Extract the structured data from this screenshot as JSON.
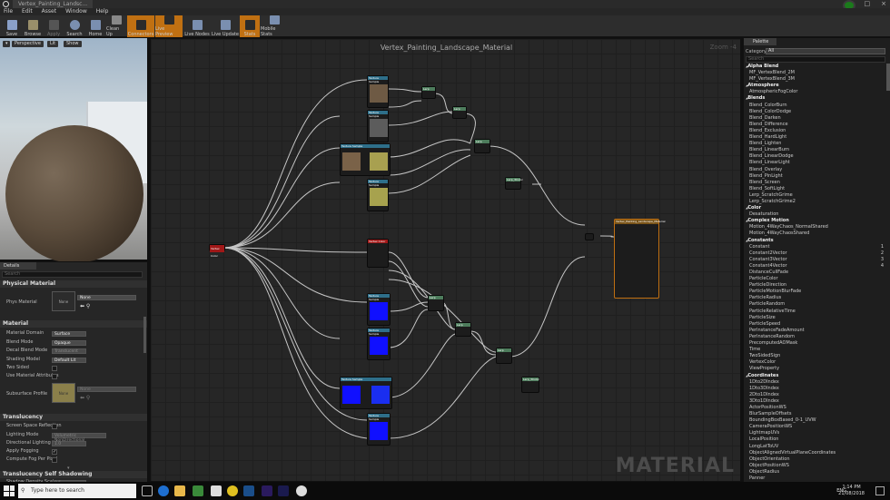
{
  "window": {
    "tab_title": "Vertex_Painting_Landsc..."
  },
  "menu": [
    "File",
    "Edit",
    "Asset",
    "Window",
    "Help"
  ],
  "toolbar": [
    {
      "label": "Save",
      "icon": "save-icon",
      "active": false
    },
    {
      "label": "Browse",
      "icon": "browse-icon",
      "active": false
    },
    {
      "label": "Apply",
      "icon": "apply-icon",
      "active": false
    },
    {
      "label": "Search",
      "icon": "search-icon",
      "active": false
    },
    {
      "label": "Home",
      "icon": "home-icon",
      "active": false
    },
    {
      "label": "Clean Up",
      "icon": "cleanup-icon",
      "active": false
    },
    {
      "label": "Connectors",
      "icon": "connectors-icon",
      "active": true
    },
    {
      "label": "Live Preview",
      "icon": "live-preview-icon",
      "active": true
    },
    {
      "label": "Live Nodes",
      "icon": "live-nodes-icon",
      "active": false
    },
    {
      "label": "Live Update",
      "icon": "live-update-icon",
      "active": false
    },
    {
      "label": "Stats",
      "icon": "stats-icon",
      "active": true
    },
    {
      "label": "Mobile Stats",
      "icon": "mobile-stats-icon",
      "active": false
    }
  ],
  "viewport": {
    "buttons": [
      "Perspective",
      "Lit",
      "Show"
    ]
  },
  "details": {
    "tab": "Details",
    "search_placeholder": "Search",
    "physical_material": {
      "header": "Physical Material",
      "label": "Phys Material",
      "thumb_text": "None",
      "value": "None"
    },
    "material": {
      "header": "Material",
      "rows": [
        {
          "label": "Material Domain",
          "value": "Surface"
        },
        {
          "label": "Blend Mode",
          "value": "Opaque"
        },
        {
          "label": "Decal Blend Mode",
          "value": "Translucent"
        },
        {
          "label": "Shading Model",
          "value": "Default Lit"
        }
      ],
      "two_sided": "Two Sided",
      "use_attributes": "Use Material Attributes",
      "subsurface": "Subsurface Profile",
      "subsurface_thumb": "None",
      "subsurface_value": "None"
    },
    "translucency": {
      "header": "Translucency",
      "rows": [
        {
          "label": "Screen Space Reflection",
          "type": "check",
          "checked": false
        },
        {
          "label": "Lighting Mode",
          "type": "dropdown",
          "value": "Volumetric NonDirectional"
        },
        {
          "label": "Directional Lighting Inte",
          "type": "number",
          "value": "1.0"
        },
        {
          "label": "Apply Fogging",
          "type": "check",
          "checked": true
        },
        {
          "label": "Compute Fog Per Pixel",
          "type": "check",
          "checked": false
        }
      ]
    },
    "translucency_self_shadowing": {
      "header": "Translucency Self Shadowing",
      "label": "Shadow Density Scale",
      "value": "0.5"
    }
  },
  "graph": {
    "title": "Vertex_Painting_Landscape_Material",
    "zoom": "Zoom -4",
    "watermark": "MATERIAL",
    "result_node": "Vertex_Painting_Landscape_Material",
    "vertex_color_node": "Vertex Color",
    "texture_node": "Texture Sample",
    "lerp_node": "Lerp",
    "lerp_3color_node": "Lerp_3Color",
    "pins": [
      "Base Color",
      "Metallic",
      "Specular",
      "Roughness",
      "Emissive Color",
      "Opacity",
      "Opacity Mask",
      "Normal",
      "World Position Offset",
      "World Displacement",
      "Tessellation Multiplier",
      "Subsurface Color",
      "Custom Data 0",
      "Custom Data 1",
      "Ambient Occlusion",
      "Refraction",
      "Pixel Depth Offset"
    ]
  },
  "palette": {
    "tab": "Palette",
    "category_label": "Category",
    "category_value": "All",
    "search_placeholder": "Search",
    "items": [
      {
        "t": "Alpha Blend",
        "h": true
      },
      {
        "t": "MF_VertexBlend_2M"
      },
      {
        "t": "MF_VertexBlend_3M"
      },
      {
        "t": "Atmosphere",
        "h": true
      },
      {
        "t": "AtmosphericFogColor"
      },
      {
        "t": "Blends",
        "h": true
      },
      {
        "t": "Blend_ColorBurn"
      },
      {
        "t": "Blend_ColorDodge"
      },
      {
        "t": "Blend_Darken"
      },
      {
        "t": "Blend_Difference"
      },
      {
        "t": "Blend_Exclusion"
      },
      {
        "t": "Blend_HardLight"
      },
      {
        "t": "Blend_Lighten"
      },
      {
        "t": "Blend_LinearBurn"
      },
      {
        "t": "Blend_LinearDodge"
      },
      {
        "t": "Blend_LinearLight"
      },
      {
        "t": "Blend_Overlay"
      },
      {
        "t": "Blend_PinLight"
      },
      {
        "t": "Blend_Screen"
      },
      {
        "t": "Blend_SoftLight"
      },
      {
        "t": "Lerp_ScratchGrime"
      },
      {
        "t": "Lerp_ScratchGrime2"
      },
      {
        "t": "Color",
        "h": true
      },
      {
        "t": "Desaturation"
      },
      {
        "t": "Complex Motion",
        "h": true
      },
      {
        "t": "Motion_4WayChaos_NormalShared"
      },
      {
        "t": "Motion_4WayChaosShared"
      },
      {
        "t": "Constants",
        "h": true
      },
      {
        "t": "Constant",
        "k": "1"
      },
      {
        "t": "Constant2Vector",
        "k": "2"
      },
      {
        "t": "Constant3Vector",
        "k": "3"
      },
      {
        "t": "Constant4Vector",
        "k": "4"
      },
      {
        "t": "DistanceCullFade"
      },
      {
        "t": "ParticleColor"
      },
      {
        "t": "ParticleDirection"
      },
      {
        "t": "ParticleMotionBlurFade"
      },
      {
        "t": "ParticleRadius"
      },
      {
        "t": "ParticleRandom"
      },
      {
        "t": "ParticleRelativeTime"
      },
      {
        "t": "ParticleSize"
      },
      {
        "t": "ParticleSpeed"
      },
      {
        "t": "PerInstanceFadeAmount"
      },
      {
        "t": "PerInstanceRandom"
      },
      {
        "t": "PrecomputedAOMask"
      },
      {
        "t": "Time"
      },
      {
        "t": "TwoSidedSign"
      },
      {
        "t": "VertexColor"
      },
      {
        "t": "ViewProperty"
      },
      {
        "t": "Coordinates",
        "h": true
      },
      {
        "t": "1Dto2DIndex"
      },
      {
        "t": "1Dto3DIndex"
      },
      {
        "t": "2Dto1DIndex"
      },
      {
        "t": "3Dto1DIndex"
      },
      {
        "t": "ActorPositionWS"
      },
      {
        "t": "BlurSampleOffsets"
      },
      {
        "t": "BoundingBoxBased_0-1_UVW"
      },
      {
        "t": "CameraPositionWS"
      },
      {
        "t": "LightmapUVs"
      },
      {
        "t": "LocalPosition"
      },
      {
        "t": "LongLatToUV"
      },
      {
        "t": "ObjectAlignedVirtualPlaneCoordinates"
      },
      {
        "t": "ObjectOrientation"
      },
      {
        "t": "ObjectPositionWS"
      },
      {
        "t": "ObjectRadius"
      },
      {
        "t": "Panner"
      }
    ]
  },
  "taskbar": {
    "search_placeholder": "Type here to search",
    "lang": "ENG",
    "time": "1:14 PM",
    "date": "21/08/2018"
  },
  "colors": {
    "accent": "#c07012",
    "wire": "#d8d8d8",
    "blue_tex": "#1010ff",
    "vertex_color_header": "#a01818",
    "tex_header": "#2e6f8a"
  }
}
